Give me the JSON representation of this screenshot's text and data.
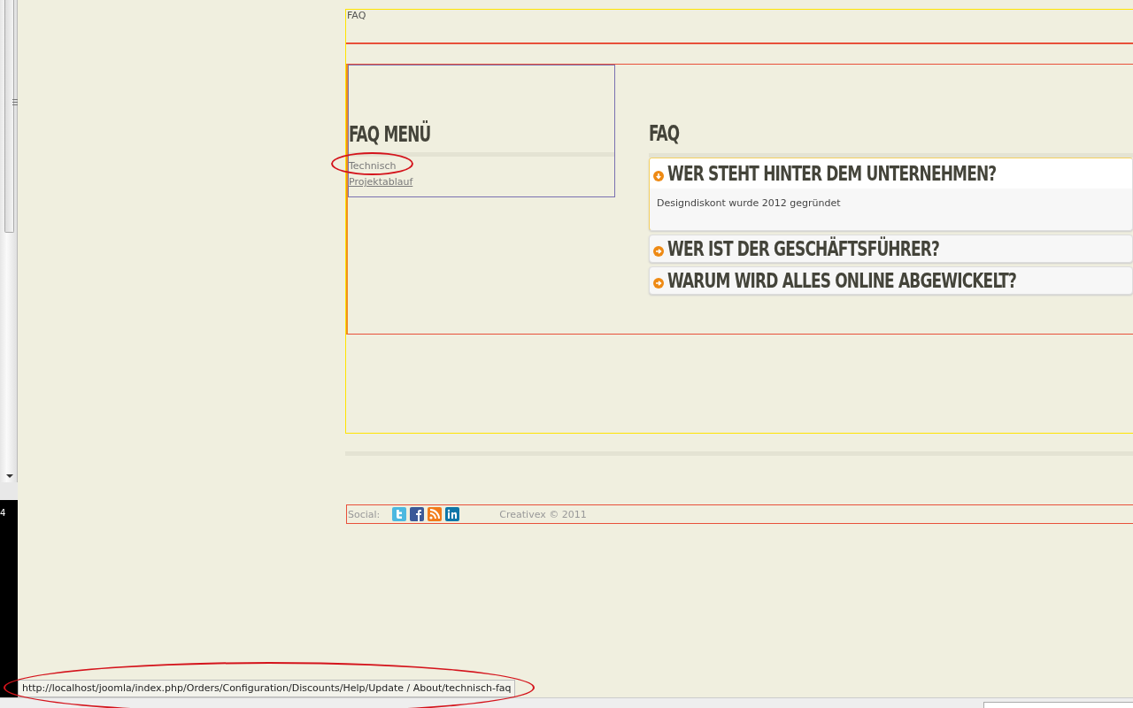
{
  "edge_label": "4",
  "breadcrumb": "FAQ",
  "sidebar": {
    "title": "FAQ MENÜ",
    "items": [
      {
        "label": "Technisch",
        "selected": true
      },
      {
        "label": "Projektablauf",
        "selected": false
      }
    ]
  },
  "faq": {
    "title": "FAQ",
    "items": [
      {
        "question": "WER STEHT HINTER DEM UNTERNEHMEN?",
        "expanded": true,
        "answer": "Designdiskont wurde 2012 gegründet"
      },
      {
        "question": "WER IST DER GESCHÄFTSFÜHRER?",
        "expanded": false
      },
      {
        "question": "WARUM WIRD ALLES ONLINE ABGEWICKELT?",
        "expanded": false
      }
    ]
  },
  "footer": {
    "social_label": "Social:",
    "copyright": "Creativex © 2011"
  },
  "status_url": "http://localhost/joomla/index.php/Orders/Configuration/Discounts/Help/Update / About/technisch-faq"
}
